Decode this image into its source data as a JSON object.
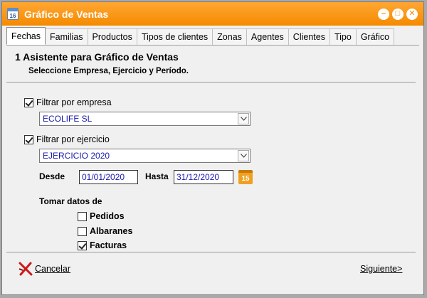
{
  "window": {
    "title": "Gráfico de Ventas",
    "app_icon_text": "16"
  },
  "tabs": [
    {
      "label": "Fechas",
      "active": true
    },
    {
      "label": "Familias"
    },
    {
      "label": "Productos"
    },
    {
      "label": "Tipos de clientes"
    },
    {
      "label": "Zonas"
    },
    {
      "label": "Agentes"
    },
    {
      "label": "Clientes"
    },
    {
      "label": "Tipo"
    },
    {
      "label": "Gráfico"
    }
  ],
  "wizard": {
    "heading": "1 Asistente para Gráfico de Ventas",
    "subheading": "Seleccione Empresa, Ejercicio y Período."
  },
  "filters": {
    "empresa": {
      "label": "Filtrar por empresa",
      "checked": true,
      "value": "ECOLIFE SL"
    },
    "ejercicio": {
      "label": "Filtrar por ejercicio",
      "checked": true,
      "value": "EJERCICIO 2020"
    },
    "desde_label": "Desde",
    "desde_value": "01/01/2020",
    "hasta_label": "Hasta",
    "hasta_value": "31/12/2020",
    "calendar_day": "15"
  },
  "data_source": {
    "label": "Tomar datos de",
    "options": [
      {
        "label": "Pedidos",
        "checked": false
      },
      {
        "label": "Albaranes",
        "checked": false
      },
      {
        "label": "Facturas",
        "checked": true
      }
    ]
  },
  "footer": {
    "cancel_label": "Cancelar",
    "next_label": "Siguiente>"
  },
  "colors": {
    "titlebar": "#f58a00",
    "value_text": "#1a1ab0",
    "cancel_icon": "#cc1a1a"
  }
}
